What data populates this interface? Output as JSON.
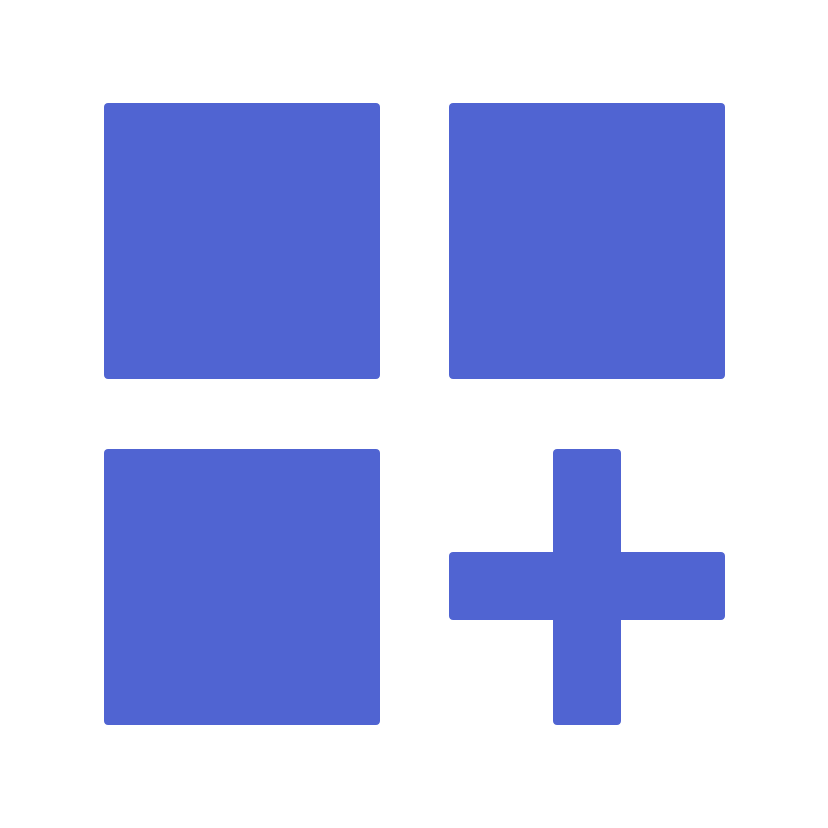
{
  "icon": {
    "name": "add-widget-icon",
    "color": "#5064D2",
    "background": "#FFFFFF"
  }
}
